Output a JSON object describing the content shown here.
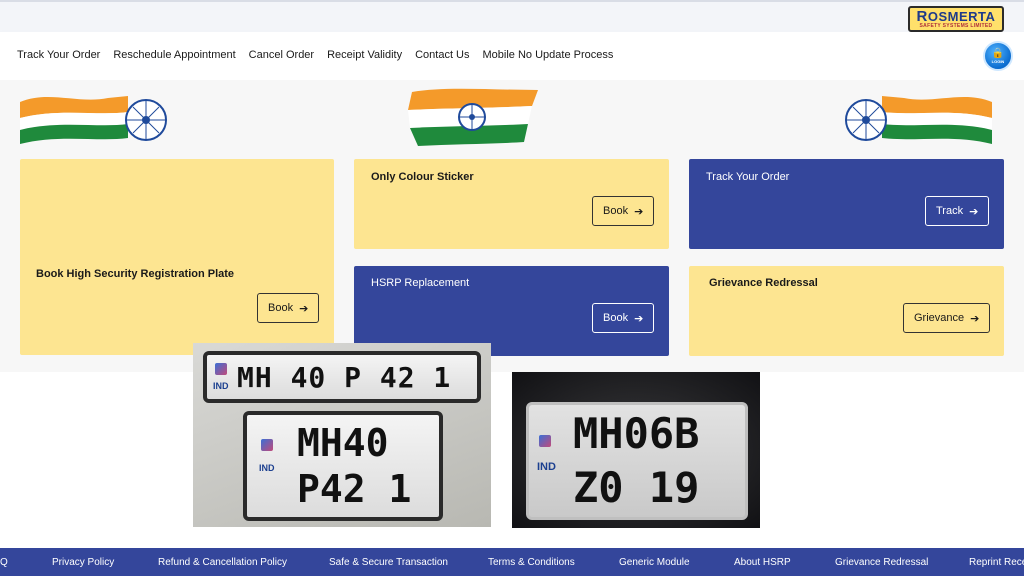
{
  "brand": {
    "name_initial": "R",
    "name_rest": "OSMERTA",
    "tagline": "SAFETY SYSTEMS LIMITED"
  },
  "nav": {
    "items": [
      "Track Your Order",
      "Reschedule Appointment",
      "Cancel Order",
      "Receipt Validity",
      "Contact Us",
      "Mobile No Update Process"
    ],
    "login_label": "LOGIN"
  },
  "cards": {
    "book_hsrp": {
      "title": "Book High Security Registration Plate",
      "button": "Book"
    },
    "colour_sticker": {
      "title": "Only Colour Sticker",
      "button": "Book"
    },
    "track_order": {
      "title": "Track Your Order",
      "button": "Track"
    },
    "hsrp_replacement": {
      "title": "HSRP Replacement",
      "button": "Book"
    },
    "grievance": {
      "title": "Grievance Redressal",
      "button": "Grievance"
    }
  },
  "plates": {
    "long_plate": {
      "text": "MH 40 P 42 1",
      "ind": "IND"
    },
    "square_plate": {
      "line1": "MH40",
      "line2": "P42 1",
      "ind": "IND"
    },
    "right_plate": {
      "line1": "MH06B",
      "line2": "Z0 19",
      "ind": "IND"
    }
  },
  "footer": {
    "items": [
      "Q",
      "Privacy Policy",
      "Refund & Cancellation Policy",
      "Safe & Secure Transaction",
      "Terms & Conditions",
      "Generic Module",
      "About HSRP",
      "Grievance Redressal",
      "Reprint Rece"
    ]
  },
  "colors": {
    "accent_blue": "#34469b",
    "card_yellow": "#fde591",
    "side_green": "#3ed75a"
  }
}
